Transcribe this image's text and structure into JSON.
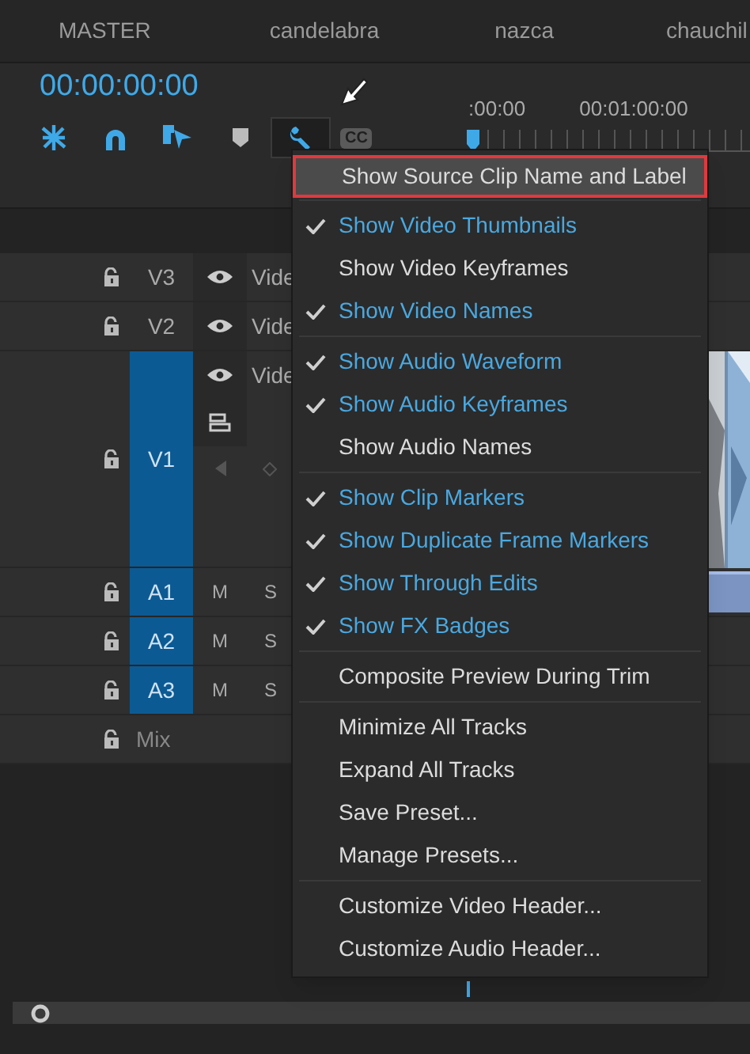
{
  "sequence_tabs": [
    "MASTER",
    "candelabra",
    "nazca",
    "chauchil"
  ],
  "timecode": "00:00:00:00",
  "cc_label": "CC",
  "ruler_labels": [
    ":00:00",
    "00:01:00:00"
  ],
  "tracks": [
    {
      "name": "V3",
      "kind": "video",
      "targeted": false,
      "clip_label": "Vide"
    },
    {
      "name": "V2",
      "kind": "video",
      "targeted": false,
      "clip_label": "Vide"
    },
    {
      "name": "V1",
      "kind": "video_expanded",
      "targeted": true,
      "clip_label": "Vide"
    },
    {
      "name": "A1",
      "kind": "audio",
      "targeted": true,
      "mute": "M",
      "solo": "S"
    },
    {
      "name": "A2",
      "kind": "audio",
      "targeted": true,
      "mute": "M",
      "solo": "S"
    },
    {
      "name": "A3",
      "kind": "audio",
      "targeted": true,
      "mute": "M",
      "solo": "S"
    },
    {
      "name": "Mix",
      "kind": "mix"
    }
  ],
  "menu": {
    "groups": [
      [
        {
          "label": "Show Source Clip Name and Label",
          "checked": false,
          "highlighted": true,
          "outlined": true
        }
      ],
      [
        {
          "label": "Show Video Thumbnails",
          "checked": true,
          "highlighted": false,
          "outlined": false
        },
        {
          "label": "Show Video Keyframes",
          "checked": false,
          "highlighted": false,
          "outlined": false
        },
        {
          "label": "Show Video Names",
          "checked": true,
          "highlighted": false,
          "outlined": false
        }
      ],
      [
        {
          "label": "Show Audio Waveform",
          "checked": true,
          "highlighted": false,
          "outlined": false
        },
        {
          "label": "Show Audio Keyframes",
          "checked": true,
          "highlighted": false,
          "outlined": false
        },
        {
          "label": "Show Audio Names",
          "checked": false,
          "highlighted": false,
          "outlined": false
        }
      ],
      [
        {
          "label": "Show Clip Markers",
          "checked": true,
          "highlighted": false,
          "outlined": false
        },
        {
          "label": "Show Duplicate Frame Markers",
          "checked": true,
          "highlighted": false,
          "outlined": false
        },
        {
          "label": "Show Through Edits",
          "checked": true,
          "highlighted": false,
          "outlined": false
        },
        {
          "label": "Show FX Badges",
          "checked": true,
          "highlighted": false,
          "outlined": false
        }
      ],
      [
        {
          "label": "Composite Preview During Trim",
          "checked": false,
          "highlighted": false,
          "outlined": false
        }
      ],
      [
        {
          "label": "Minimize All Tracks",
          "checked": false,
          "highlighted": false,
          "outlined": false
        },
        {
          "label": "Expand All Tracks",
          "checked": false,
          "highlighted": false,
          "outlined": false
        },
        {
          "label": "Save Preset...",
          "checked": false,
          "highlighted": false,
          "outlined": false
        },
        {
          "label": "Manage Presets...",
          "checked": false,
          "highlighted": false,
          "outlined": false
        }
      ],
      [
        {
          "label": "Customize Video Header...",
          "checked": false,
          "highlighted": false,
          "outlined": false
        },
        {
          "label": "Customize Audio Header...",
          "checked": false,
          "highlighted": false,
          "outlined": false
        }
      ]
    ]
  }
}
